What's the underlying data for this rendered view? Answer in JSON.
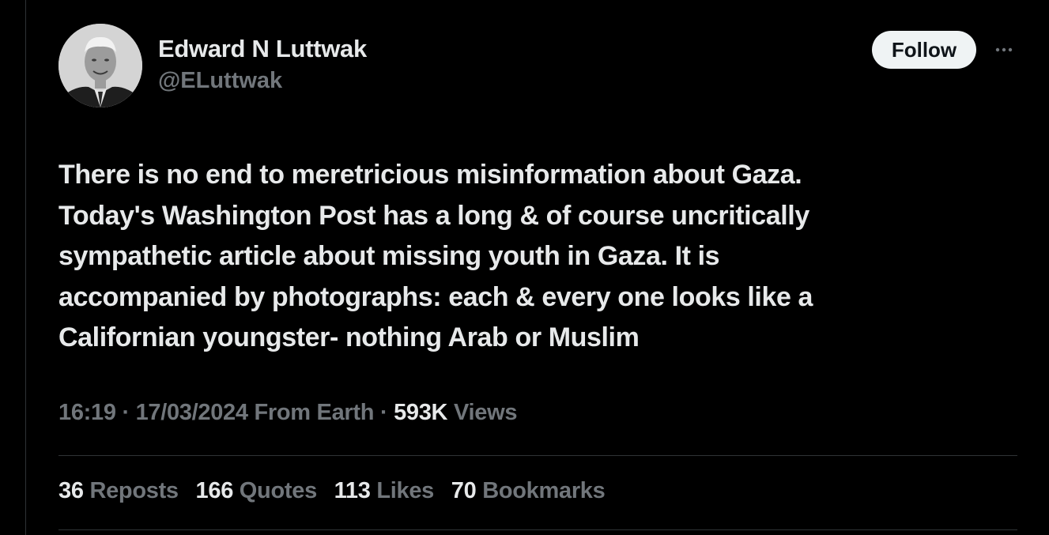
{
  "author": {
    "display_name": "Edward N Luttwak",
    "handle": "@ELuttwak"
  },
  "follow_label": "Follow",
  "more_icon": "more-horizontal-icon",
  "tweet": {
    "text": "There is no end to meretricious misinformation about Gaza.\nToday's  Washington Post has a long & of course uncritically\nsympathetic article about missing youth in Gaza. It is\naccompanied by photographs: each & every one looks like a\nCalifornian youngster- nothing  Arab or Muslim"
  },
  "meta": {
    "time": "16:19",
    "separator": "·",
    "date": "17/03/2024",
    "source": "From Earth",
    "views_count": "593K",
    "views_label": "Views"
  },
  "stats": {
    "reposts": {
      "count": "36",
      "label": "Reposts"
    },
    "quotes": {
      "count": "166",
      "label": "Quotes"
    },
    "likes": {
      "count": "113",
      "label": "Likes"
    },
    "bookmarks": {
      "count": "70",
      "label": "Bookmarks"
    }
  },
  "colors": {
    "background": "#000000",
    "primary_text": "#e7e9ea",
    "secondary_text": "#71767b",
    "divider": "#2f3336",
    "follow_bg": "#eff3f4"
  }
}
